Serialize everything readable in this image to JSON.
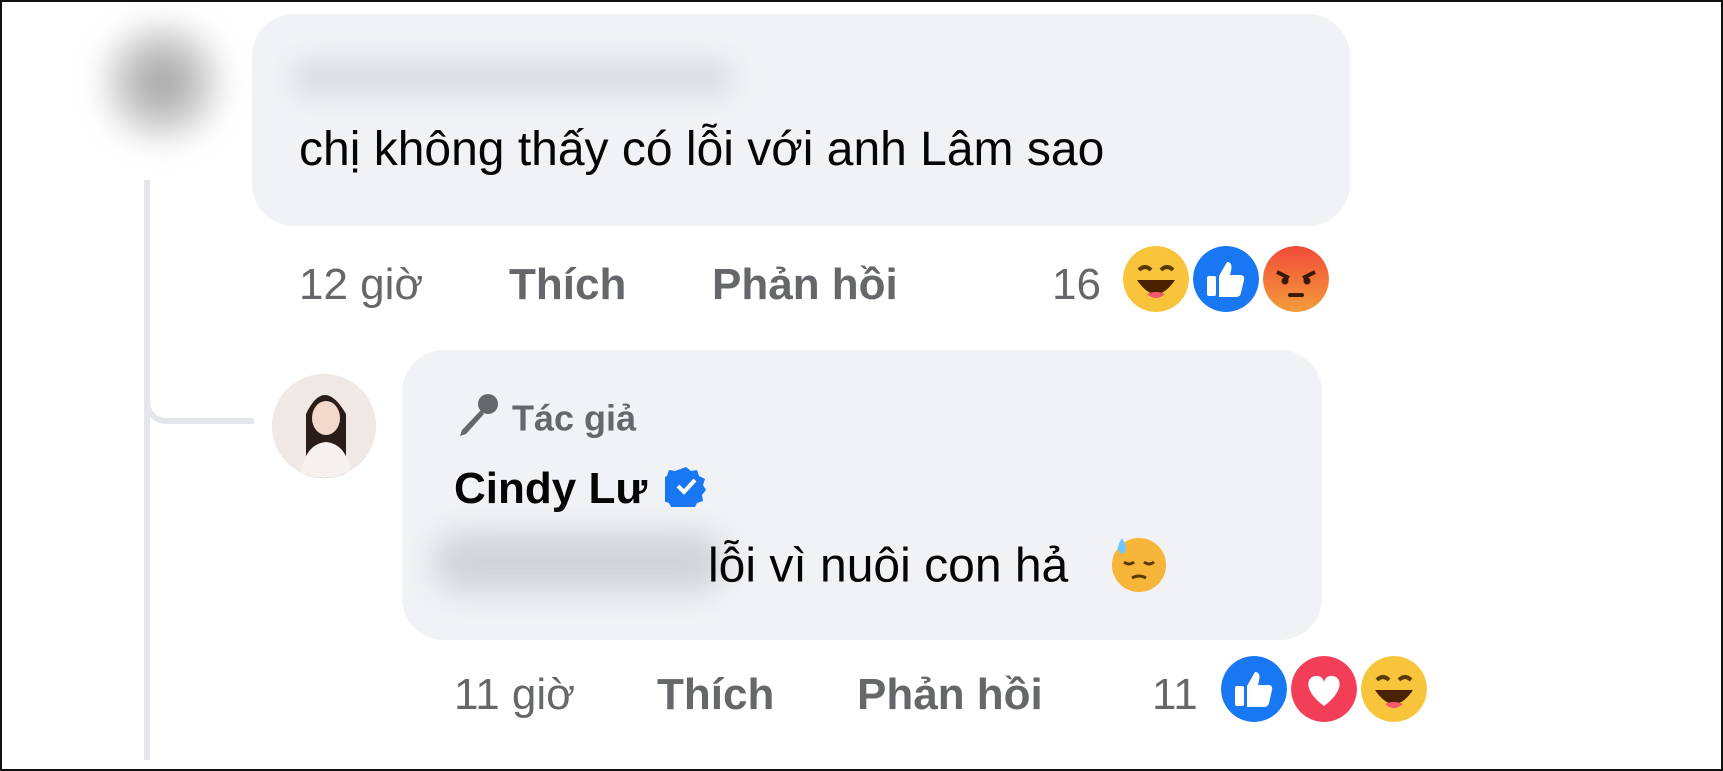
{
  "comment": {
    "text": "chị không thấy có lỗi với anh Lâm sao",
    "time": "12 giờ",
    "like_label": "Thích",
    "reply_label": "Phản hồi",
    "reaction_count": "16",
    "reactions": [
      "haha-icon",
      "like-icon",
      "angry-icon"
    ]
  },
  "reply": {
    "author_badge": "Tác giả",
    "author_name": "Cindy Lư",
    "text": "lỗi vì nuôi con hả",
    "time": "11 giờ",
    "like_label": "Thích",
    "reply_label": "Phản hồi",
    "reaction_count": "11",
    "reactions": [
      "like-icon",
      "love-icon",
      "haha-icon"
    ]
  },
  "colors": {
    "bubble": "#f0f2f5",
    "secondary_text": "#65676b",
    "like_blue": "#1877f2",
    "love_red": "#f33e58",
    "verified_blue": "#1877f2"
  }
}
